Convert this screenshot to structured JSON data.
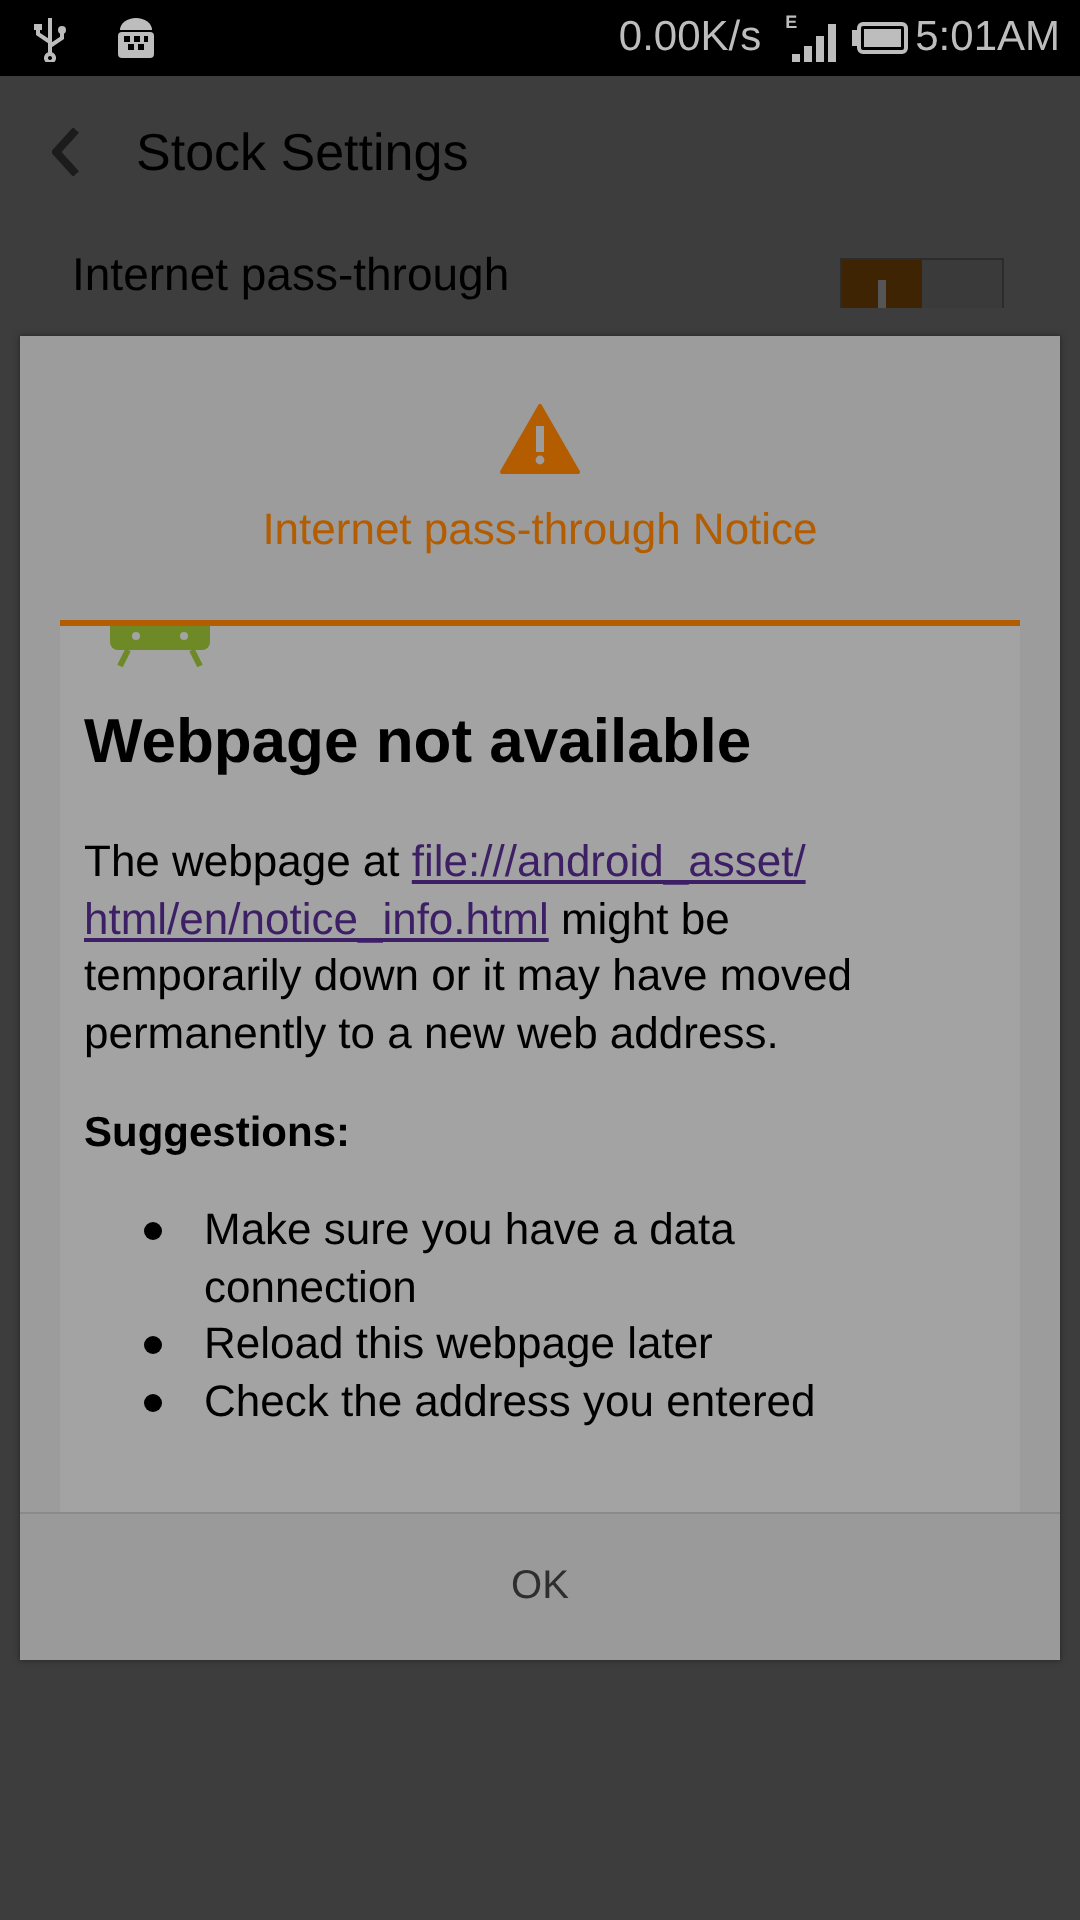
{
  "status_bar": {
    "speed": "0.00K/s",
    "network": "E",
    "time": "5:01AM"
  },
  "app_bar": {
    "title": "Stock Settings"
  },
  "settings": [
    {
      "title": "Internet pass-through",
      "on": true
    }
  ],
  "dialog": {
    "title": "Internet pass-through Notice",
    "page": {
      "heading": "Webpage not available",
      "text_before": "The webpage at",
      "link_lines": [
        "file:///android_asset/",
        "html/en/notice_info.html"
      ],
      "text_after": "might be temporarily down or it may have moved permanently to a new web address.",
      "suggestions_title": "Suggestions:",
      "suggestions": [
        "Make sure you have a data connection",
        "Reload this webpage later",
        "Check the address you entered"
      ]
    },
    "buttons": [
      "OK"
    ]
  }
}
